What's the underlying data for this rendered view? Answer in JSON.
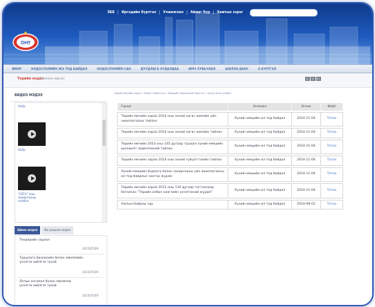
{
  "top_nav": {
    "links": [
      "ЗББ",
      "Иргэдийн бүртгэл",
      "Уламжлал",
      "Аймаг бүр",
      "Хамтын хэрэг"
    ]
  },
  "logo": {
    "text": "ОНҮ"
  },
  "main_menu": [
    "ЯМНР",
    "НОДОСЛЭЛИЙН ЖЭ ТОД БАЙДАЛ",
    "НОДОСЛЭЛИЙН САН",
    "ДУУДЛАГА ХУДАЛДАА",
    "ӨМЧ ХУВЬЧЛАЛ",
    "ШИЛЭН ДАНС",
    "Е-БҮРТГЭЛ"
  ],
  "subbar": {
    "title": "Төрийн мэдээ",
    "subtitle": "Хэнээнэ ирсэн"
  },
  "font_size_buttons": [
    "А-",
    "А",
    "А+"
  ],
  "sidebar": {
    "video_header": "ВИДЕО МЭДЭЭ",
    "video_captions": [
      "Хоёр",
      "Хоёр",
      "\"2013\" оны\nзахиргааны\nхолбоо"
    ],
    "tabs": [
      "Шинэ мэдээ",
      "Их уншсан мэдээ"
    ],
    "news": [
      {
        "title": "Тендерийн зарлал",
        "date": "2015/07/09"
      },
      {
        "title": "Туршлага Бизнесийн болон зөвлөлийн\nүнэлгээ хийлгэх тухай",
        "date": "2015/07/09"
      },
      {
        "title": "Лотын ангилал болон зөвлөгөө\nүнэлгээ хийлгэх тухай",
        "date": "2015/07/09"
      }
    ]
  },
  "breadcrumb": "Төрийн өмчийн хороо » Мэдээ тайлагнал » Нөөцийн мэдээллийг бүртгэх » Хууль ёсны холбоо",
  "table": {
    "headers": [
      "Гарчиг",
      "Ангилал",
      "Огноо",
      "Файл"
    ],
    "rows": [
      {
        "title": "Төрийн өмчийн хороо 2014 оны эхний хагас жилийн үйл ажиллагааны тайлан",
        "category": "Хүний нөөцийн ил тод байдал",
        "date": "2014-11-04",
        "file": "Татах"
      },
      {
        "title": "Төрийн өмчийн хороо 2014 оны эхний хагас жилийн тайлан",
        "category": "Хүний нөөцийн ил тод байдал",
        "date": "2014-11-04",
        "file": "Татах"
      },
      {
        "title": "Төрийн өмчийн 2014 оны 145 дугаар тушаал хүний нөөцийн шилжилт хөдөлгөөний тайлан",
        "category": "Хүний нөөцийн ил тод байдал",
        "date": "2014-11-04",
        "file": "Татах"
      },
      {
        "title": "Төрийн өмчийн хороо 2014 оны эхний гүйцэтгэлийн тайлан",
        "category": "Хүний нөөцийн ил тод байдал",
        "date": "2014-11-04",
        "file": "Татах"
      },
      {
        "title": "Хүний нөөцийн бодлого болон захиргааны үйл ажиллагааны ил тод байдлыг хангах журам",
        "category": "Хүний нөөцийн ил тод байдал",
        "date": "2014-11-04",
        "file": "Татах"
      },
      {
        "title": "Төрийн өмчийн хороо 2012 оны 134 дугаар тогтоолоор баталсан \"Төрийн албан хаагчийн үнэлгээний журам\"",
        "category": "Хүний нөөцийн ил тод байдал",
        "date": "2014-11-04",
        "file": "Татах"
      },
      {
        "title": "Ажлын байрны зар",
        "category": "Хүний нөөцийн ил тод байдал",
        "date": "2014-09-02",
        "file": "Татах"
      }
    ]
  }
}
